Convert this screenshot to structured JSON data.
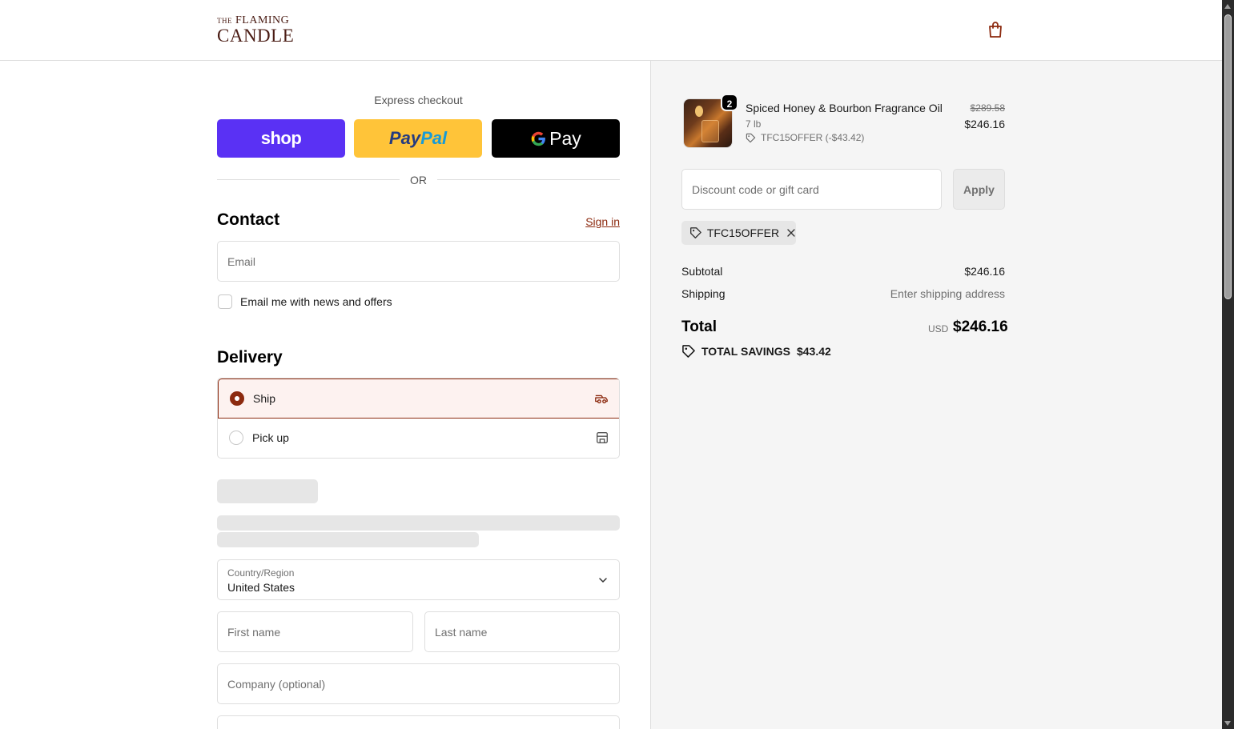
{
  "brand": {
    "name_top": "THE FLAMING",
    "name_top_prefix": "THE",
    "name_top_main": "FLAMING",
    "name_bottom": "CANDLE",
    "color": "#4a1c14"
  },
  "header": {
    "cart_icon": "shopping-bag-icon"
  },
  "express": {
    "label": "Express checkout",
    "shop_label": "shop",
    "paypal_pay": "Pay",
    "paypal_pal": "Pal",
    "gpay_g": "G",
    "gpay_label": "Pay",
    "colors": {
      "shop": "#5a31f4",
      "paypal": "#ffc439",
      "gpay": "#000000"
    }
  },
  "or_text": "OR",
  "contact": {
    "title": "Contact",
    "sign_in": "Sign in",
    "email_placeholder": "Email",
    "news_checkbox_label": "Email me with news and offers",
    "news_checked": false
  },
  "delivery": {
    "title": "Delivery",
    "options": [
      {
        "label": "Ship",
        "selected": true,
        "icon": "truck-icon"
      },
      {
        "label": "Pick up",
        "selected": false,
        "icon": "store-icon"
      }
    ],
    "country_label": "Country/Region",
    "country_value": "United States",
    "first_name_placeholder": "First name",
    "last_name_placeholder": "Last name",
    "company_placeholder": "Company (optional)"
  },
  "order": {
    "item": {
      "name": "Spiced Honey & Bourbon Fragrance Oil",
      "variant": "7 lb",
      "quantity": "2",
      "discount": "TFC15OFFER (-$43.42)",
      "original_price": "$289.58",
      "price": "$246.16"
    },
    "discount_placeholder": "Discount code or gift card",
    "apply_label": "Apply",
    "applied_code": "TFC15OFFER",
    "subtotal_label": "Subtotal",
    "subtotal_value": "$246.16",
    "shipping_label": "Shipping",
    "shipping_value": "Enter shipping address",
    "total_label": "Total",
    "currency": "USD",
    "total_value": "$246.16",
    "savings_label": "TOTAL SAVINGS",
    "savings_value": "$43.42"
  },
  "accent_color": "#8c2a0f"
}
